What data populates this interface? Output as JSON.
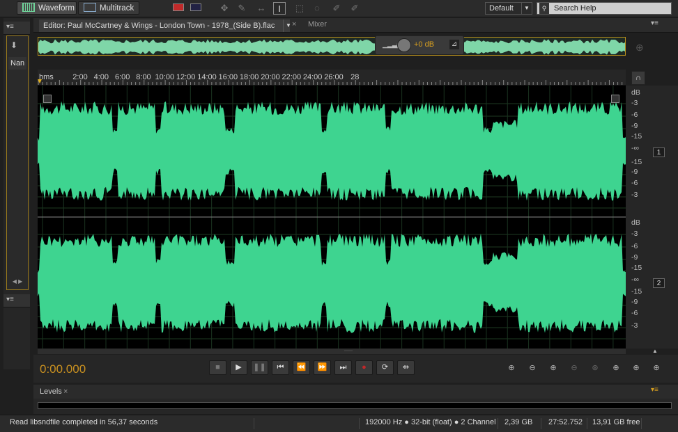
{
  "toolbar": {
    "waveform_label": "Waveform",
    "multitrack_label": "Multitrack",
    "workspace": "Default",
    "search_placeholder": "Search Help"
  },
  "panels": {
    "files_column_label": "Nan"
  },
  "editor": {
    "tab_title": "Editor: Paul McCartney & Wings - London Town - 1978_(Side B).flac",
    "mixer_tab": "Mixer",
    "hud_gain": "+0 dB",
    "ruler_unit": "hms",
    "ruler_ticks": [
      "2:00",
      "4:00",
      "6:00",
      "8:00",
      "10:00",
      "12:00",
      "14:00",
      "16:00",
      "18:00",
      "20:00",
      "22:00",
      "24:00",
      "26:00",
      "28"
    ],
    "db_unit": "dB",
    "db_scale": [
      "-3",
      "-6",
      "-9",
      "-15",
      "-∞",
      "-15",
      "-9",
      "-6",
      "-3"
    ],
    "channel_1": "1",
    "channel_2": "2",
    "waveform_color": "#3ed490"
  },
  "transport": {
    "current_time": "0:00.000"
  },
  "levels": {
    "tab_label": "Levels"
  },
  "status": {
    "message": "Read libsndfile completed in 56,37 seconds",
    "sample_info": "192000 Hz ● 32-bit (float) ● 2 Channel",
    "file_size": "2,39 GB",
    "duration": "27:52.752",
    "free_space": "13,91 GB free"
  }
}
